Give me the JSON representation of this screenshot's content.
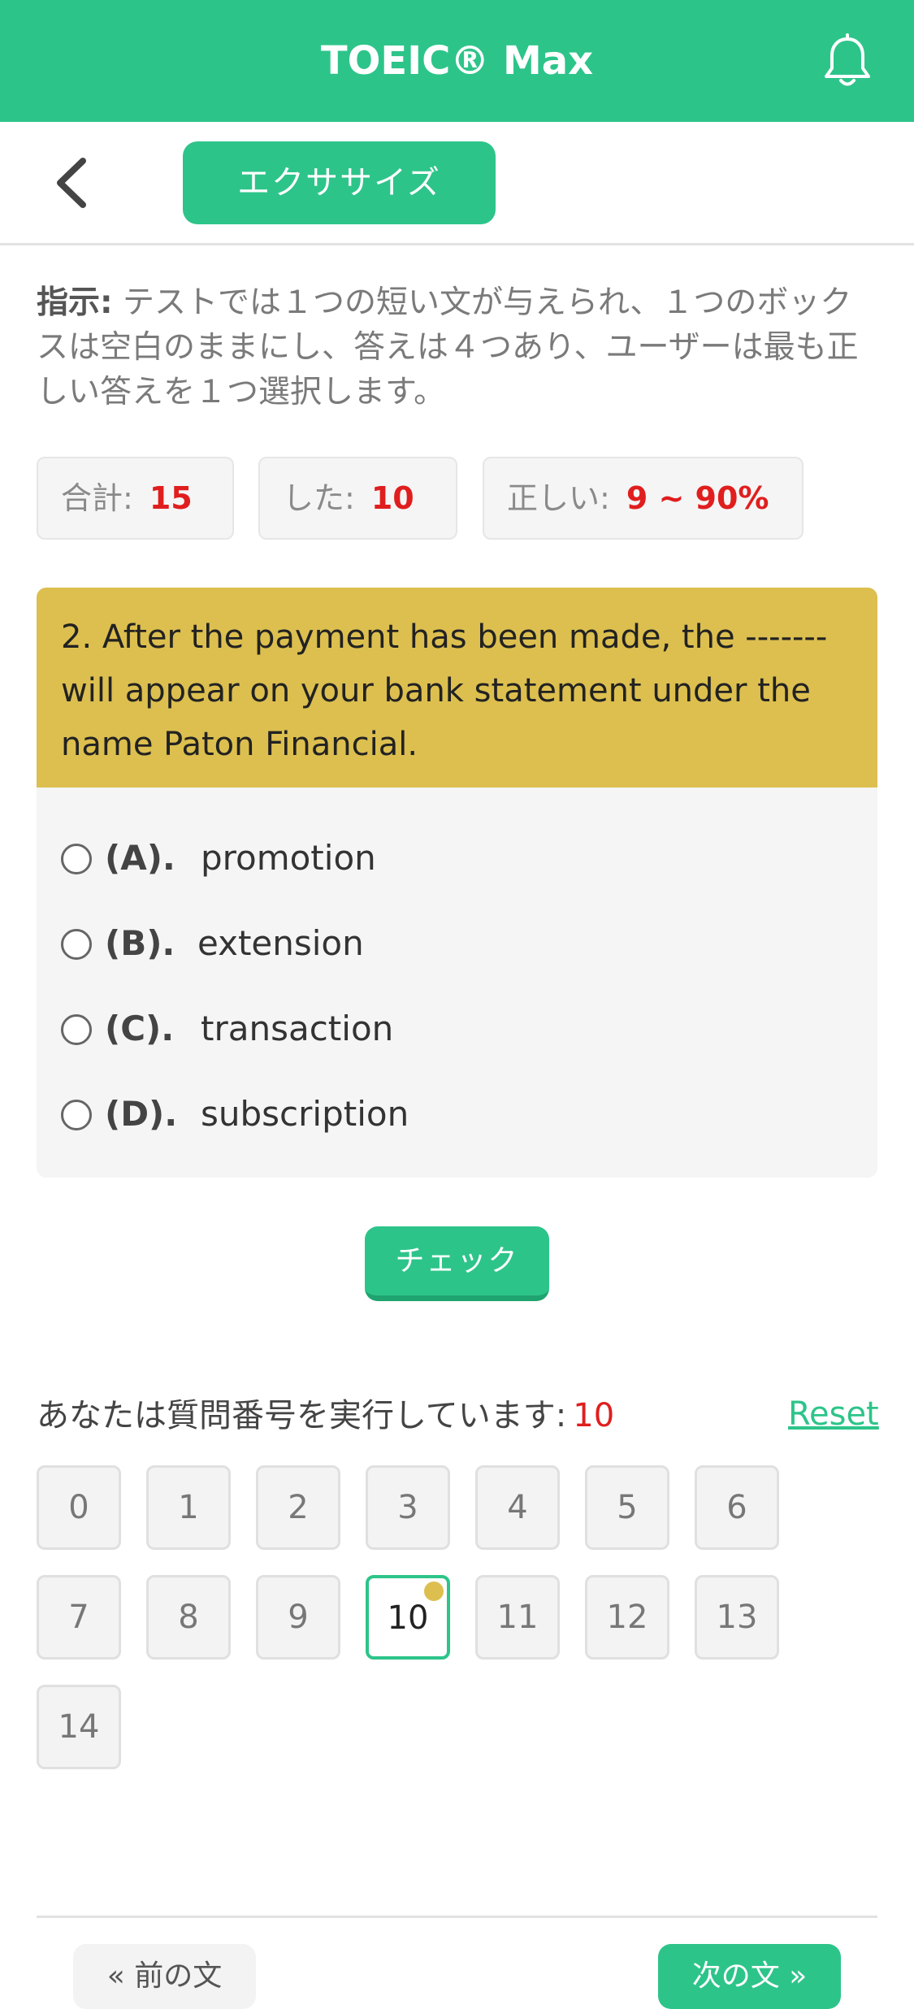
{
  "header": {
    "title": "TOEIC® Max",
    "bell_icon": "bell-icon"
  },
  "subheader": {
    "back_icon": "chevron-left-icon",
    "exercise_tab": "エクササイズ"
  },
  "instructions": {
    "label": "指示:",
    "text": " テストでは１つの短い文が与えられ、１つのボックスは空白のままにし、答えは４つあり、ユーザーは最も正しい答えを１つ選択します。"
  },
  "stats": {
    "total_label": "合計:",
    "total_value": "15",
    "done_label": "した:",
    "done_value": "10",
    "correct_label": "正しい:",
    "correct_value": "9 ~ 90%"
  },
  "question": {
    "text": "2. After the payment has been made, the ------- will appear on your bank statement under the name Paton Financial.",
    "options": [
      {
        "letter": "(A).",
        "text": "promotion"
      },
      {
        "letter": "(B).",
        "text": "extension"
      },
      {
        "letter": "(C).",
        "text": "transaction"
      },
      {
        "letter": "(D).",
        "text": "subscription"
      }
    ]
  },
  "check_button": "チェック",
  "navigator": {
    "label": "あなたは質問番号を実行しています:",
    "current": "10",
    "reset": "Reset",
    "numbers": [
      "0",
      "1",
      "2",
      "3",
      "4",
      "5",
      "6",
      "7",
      "8",
      "9",
      "10",
      "11",
      "12",
      "13",
      "14"
    ]
  },
  "bottom_nav": {
    "prev": "« 前の文",
    "next": "次の文 »"
  },
  "colors": {
    "brand": "#2dc48a",
    "question_bg": "#dcbf4f",
    "accent_red": "#e01e1e"
  }
}
